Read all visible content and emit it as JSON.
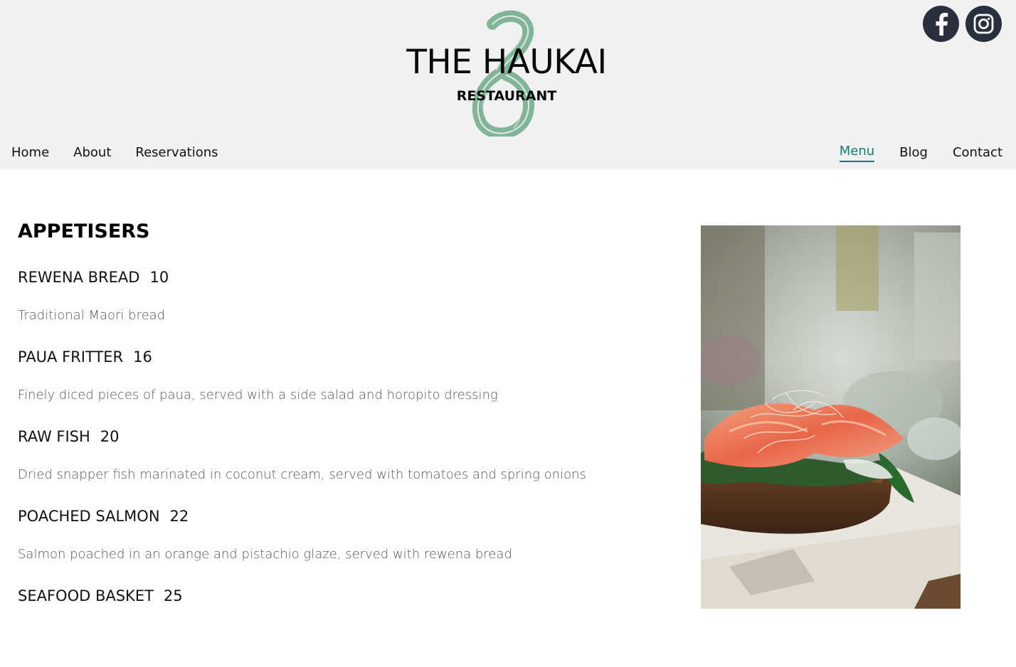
{
  "brand": {
    "title": "THE HAUKAI",
    "subtitle": "RESTAURANT",
    "logo_icon": "pounamu-hook-icon"
  },
  "social": {
    "facebook_icon": "facebook-icon",
    "instagram_icon": "instagram-icon"
  },
  "nav": {
    "left": [
      "Home",
      "About",
      "Reservations"
    ],
    "right": [
      "Menu",
      "Blog",
      "Contact"
    ],
    "active": "Menu",
    "active_color": "#147a73"
  },
  "menu": {
    "section_title": "APPETISERS",
    "items": [
      {
        "name": "REWENA BREAD",
        "price": "10",
        "description": "Traditional Maori bread"
      },
      {
        "name": "PAUA FRITTER",
        "price": "16",
        "description": "Finely diced pieces of paua, served with a side salad and horopito dressing"
      },
      {
        "name": "RAW FISH",
        "price": "20",
        "description": "Dried snapper fish marinated in coconut cream, served with tomatoes and spring onions"
      },
      {
        "name": "POACHED SALMON",
        "price": "22",
        "description": "Salmon poached in an orange and pistachio glaze, served with rewena bread"
      },
      {
        "name": "SEAFOOD BASKET",
        "price": "25",
        "description": ""
      }
    ]
  },
  "colors": {
    "header_bg": "#f1f1f1",
    "logo_green": "#6fa98a",
    "social_bg": "#2a2f3d"
  }
}
